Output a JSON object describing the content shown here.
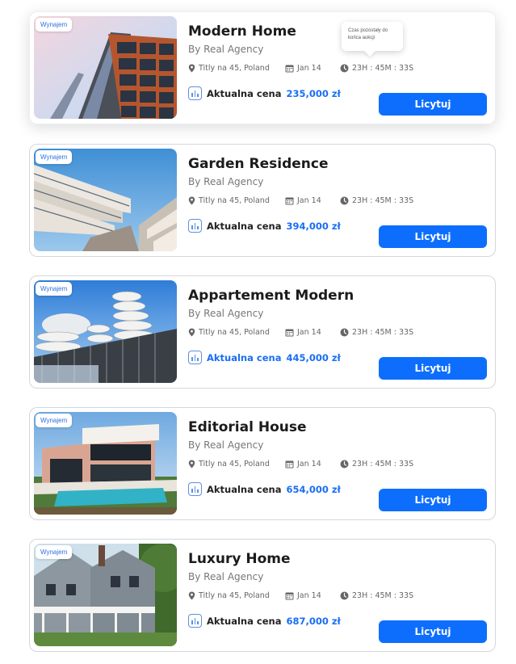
{
  "tooltip": {
    "text": "Czas pozostały do końca aukcji"
  },
  "listings": [
    {
      "badge": "Wynajem",
      "title": "Modern Home",
      "agency": "By Real Agency",
      "location": "Titly na 45, Poland",
      "date": "Jan 14",
      "time": "23H : 45M : 33S",
      "price_label": "Aktualna cena",
      "price": "235,000 zł",
      "button": "Licytuj",
      "image": "building-facade-icon"
    },
    {
      "badge": "Wynajem",
      "title": "Garden Residence",
      "agency": "By Real Agency",
      "location": "Titly na 45, Poland",
      "date": "Jan 14",
      "time": "23H : 45M : 33S",
      "price_label": "Aktualna cena",
      "price": "394,000 zł",
      "button": "Licytuj",
      "image": "balconies-icon"
    },
    {
      "badge": "Wynajem",
      "title": "Appartement Modern",
      "agency": "By Real Agency",
      "location": "Titly na 45, Poland",
      "date": "Jan 14",
      "time": "23H : 45M : 33S",
      "price_label": "Aktualna cena",
      "price": "445,000 zł",
      "button": "Licytuj",
      "image": "towers-icon"
    },
    {
      "badge": "Wynajem",
      "title": "Editorial House",
      "agency": "By Real Agency",
      "location": "Titly na 45, Poland",
      "date": "Jan 14",
      "time": "23H : 45M : 33S",
      "price_label": "Aktualna cena",
      "price": "654,000 zł",
      "button": "Licytuj",
      "image": "villa-pool-icon"
    },
    {
      "badge": "Wynajem",
      "title": "Luxury Home",
      "agency": "By Real Agency",
      "location": "Titly na 45, Poland",
      "date": "Jan 14",
      "time": "23H : 45M : 33S",
      "price_label": "Aktualna cena",
      "price": "687,000 zł",
      "button": "Licytuj",
      "image": "victorian-house-icon"
    }
  ],
  "colors": {
    "accent": "#0d6efd",
    "price": "#1a6ef5",
    "badge": "#2f6fe0"
  }
}
